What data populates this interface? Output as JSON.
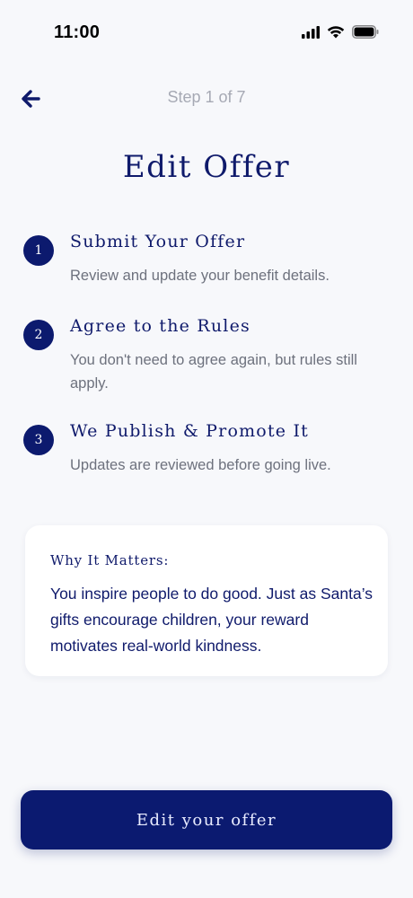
{
  "status_bar": {
    "time": "11:00",
    "icons": [
      "signal-icon",
      "wifi-icon",
      "battery-icon"
    ]
  },
  "header": {
    "back_icon": "arrow-left-icon",
    "step_indicator": "Step 1 of 7"
  },
  "title": "Edit Offer",
  "steps": [
    {
      "number": "1",
      "title": "Submit Your Offer",
      "description": "Review and update your benefit details."
    },
    {
      "number": "2",
      "title": "Agree to the Rules",
      "description": "You don't need to agree again, but rules still apply."
    },
    {
      "number": "3",
      "title": "We Publish & Promote It",
      "description": "Updates are reviewed before going live."
    }
  ],
  "info_card": {
    "title": "Why It Matters:",
    "body": "You inspire people to do good. Just as Santa’s gifts encourage children, your reward motivates real-world kindness."
  },
  "cta": {
    "label": "Edit your offer"
  },
  "colors": {
    "primary": "#0b1a70",
    "background": "#f7f8fb",
    "muted_text": "#6d717d",
    "step_indicator": "#a6a9b4"
  }
}
